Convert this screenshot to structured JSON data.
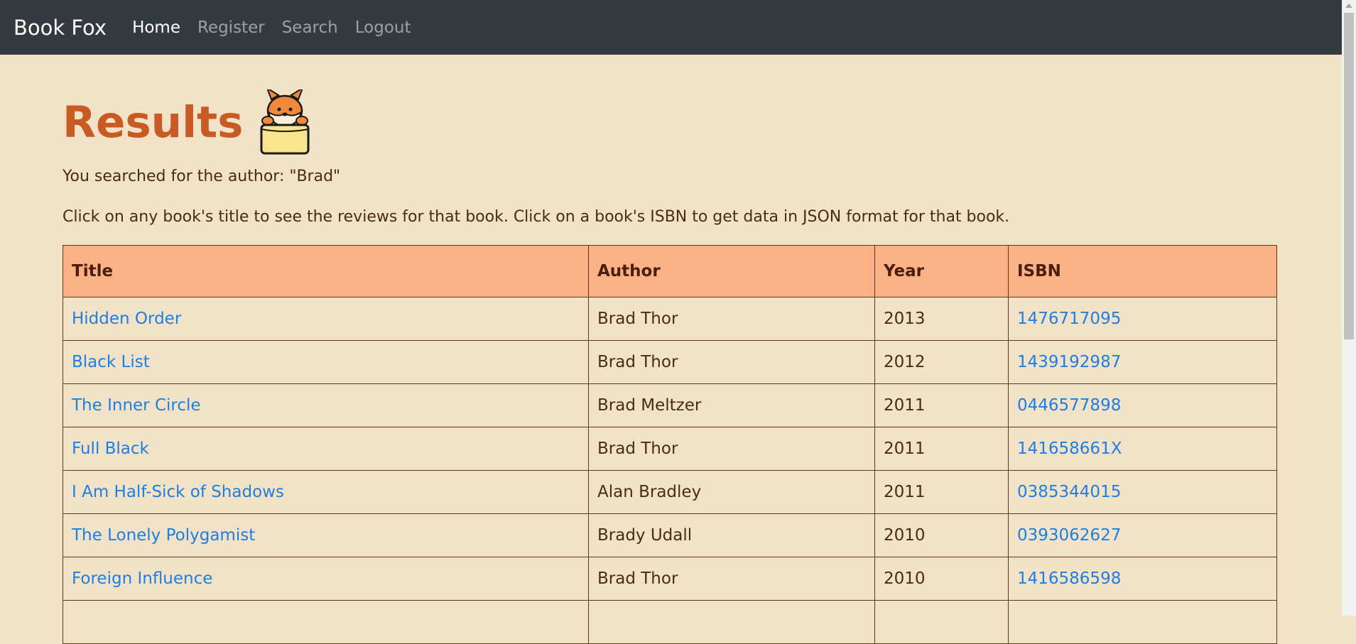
{
  "nav": {
    "brand": "Book Fox",
    "links": [
      {
        "label": "Home",
        "active": true
      },
      {
        "label": "Register",
        "active": false
      },
      {
        "label": "Search",
        "active": false
      },
      {
        "label": "Logout",
        "active": false
      }
    ]
  },
  "page": {
    "heading": "Results",
    "search_summary": "You searched for the author: \"Brad\"",
    "instructions": "Click on any book's title to see the reviews for that book. Click on a book's ISBN to get data in JSON format for that book.",
    "mascot_icon": "fox-in-box-icon"
  },
  "table": {
    "headers": [
      "Title",
      "Author",
      "Year",
      "ISBN"
    ],
    "rows": [
      {
        "title": "Hidden Order",
        "author": "Brad Thor",
        "year": "2013",
        "isbn": "1476717095"
      },
      {
        "title": "Black List",
        "author": "Brad Thor",
        "year": "2012",
        "isbn": "1439192987"
      },
      {
        "title": "The Inner Circle",
        "author": "Brad Meltzer",
        "year": "2011",
        "isbn": "0446577898"
      },
      {
        "title": "Full Black",
        "author": "Brad Thor",
        "year": "2011",
        "isbn": "141658661X"
      },
      {
        "title": "I Am Half-Sick of Shadows",
        "author": "Alan Bradley",
        "year": "2011",
        "isbn": "0385344015"
      },
      {
        "title": "The Lonely Polygamist",
        "author": "Brady Udall",
        "year": "2010",
        "isbn": "0393062627"
      },
      {
        "title": "Foreign Influence",
        "author": "Brad Thor",
        "year": "2010",
        "isbn": "1416586598"
      },
      {
        "title": "",
        "author": "",
        "year": "",
        "isbn": ""
      }
    ]
  },
  "colors": {
    "background": "#f1e2c8",
    "navbar": "#343a40",
    "heading": "#c75b23",
    "table_header": "#f9b185",
    "link": "#1e7fe0"
  }
}
